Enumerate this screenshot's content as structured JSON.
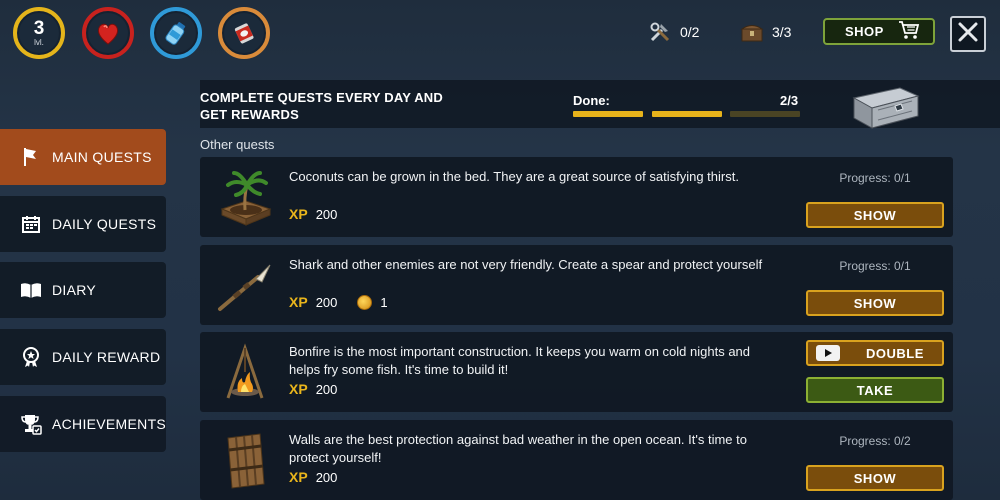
{
  "topbar": {
    "level": {
      "value": "3",
      "label": "lvl."
    },
    "stats": [
      {
        "icon": "heart-icon",
        "ring_color": "#c8221e"
      },
      {
        "icon": "water-bottle-icon",
        "ring_color": "#2f9ad8"
      },
      {
        "icon": "food-can-icon",
        "ring_color": "#d98b3a"
      }
    ],
    "level_ring_color": "#e5b51b",
    "tools_counter": "0/2",
    "chests_counter": "3/3",
    "shop_label": "SHOP"
  },
  "header": {
    "text": "COMPLETE QUESTS EVERY DAY AND GET REWARDS",
    "done_label": "Done:",
    "done_count": "2/3",
    "done_fraction": 0.667,
    "bar_color": "#e7b31b",
    "bar_empty_color": "#4a4424"
  },
  "section_title": "Other quests",
  "sidebar": {
    "items": [
      {
        "label": "MAIN QUESTS",
        "icon": "flag-icon",
        "active": true
      },
      {
        "label": "DAILY QUESTS",
        "icon": "calendar-icon",
        "active": false
      },
      {
        "label": "DIARY",
        "icon": "book-icon",
        "active": false
      },
      {
        "label": "DAILY REWARD",
        "icon": "medal-icon",
        "active": false
      },
      {
        "label": "ACHIEVEMENTS",
        "icon": "trophy-icon",
        "active": false
      }
    ]
  },
  "quests": [
    {
      "icon": "palm-bed-icon",
      "text": "Coconuts can be grown in the bed. They are a great source of satisfying thirst.",
      "xp_label": "XP",
      "xp": "200",
      "progress": "Progress: 0/1",
      "button": "SHOW"
    },
    {
      "icon": "spear-icon",
      "text": "Shark and other enemies are not very friendly. Create a spear and protect yourself",
      "xp_label": "XP",
      "xp": "200",
      "coins": "1",
      "progress": "Progress: 0/1",
      "button": "SHOW"
    },
    {
      "icon": "bonfire-icon",
      "text": "Bonfire is the most important construction. It keeps you warm on cold nights and helps fry some fish. It's time to build it!",
      "xp_label": "XP",
      "xp": "200",
      "double_label": "DOUBLE",
      "take_label": "TAKE"
    },
    {
      "icon": "wooden-wall-icon",
      "text": "Walls are the best protection against bad weather in the open ocean. It's time to protect yourself!",
      "xp_label": "XP",
      "xp": "200",
      "progress": "Progress: 0/2",
      "button": "SHOW"
    }
  ]
}
